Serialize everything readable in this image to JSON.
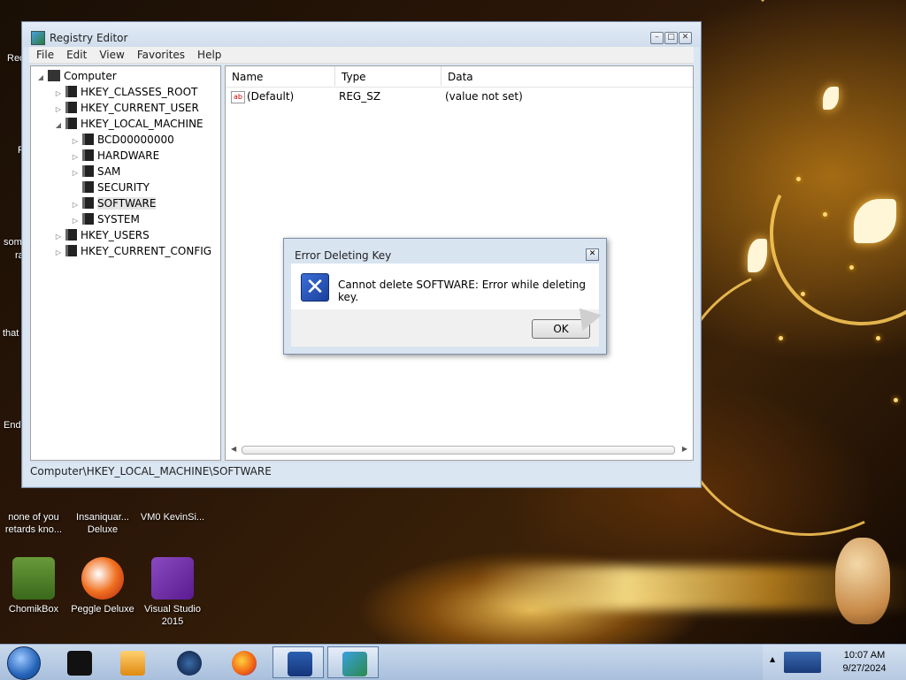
{
  "window": {
    "title": "Registry Editor",
    "minimize": "–",
    "maximize": "□",
    "close": "✕"
  },
  "menu": [
    "File",
    "Edit",
    "View",
    "Favorites",
    "Help"
  ],
  "tree": {
    "root": "Computer",
    "hkcr": "HKEY_CLASSES_ROOT",
    "hkcu": "HKEY_CURRENT_USER",
    "hklm": "HKEY_LOCAL_MACHINE",
    "hklm_children": [
      "BCD00000000",
      "HARDWARE",
      "SAM",
      "SECURITY",
      "SOFTWARE",
      "SYSTEM"
    ],
    "hku": "HKEY_USERS",
    "hkcc": "HKEY_CURRENT_CONFIG",
    "expander_open": "◢",
    "expander_closed": "▷"
  },
  "list": {
    "headers": [
      "Name",
      "Type",
      "Data"
    ],
    "rows": [
      {
        "name": "(Default)",
        "type": "REG_SZ",
        "data": "(value not set)"
      }
    ],
    "value_icon_text": "ab"
  },
  "statusbar": "Computer\\HKEY_LOCAL_MACHINE\\SOFTWARE",
  "dialog": {
    "title": "Error Deleting Key",
    "message": "Cannot delete SOFTWARE:  Error while deleting key.",
    "ok": "OK",
    "icon_glyph": "✕",
    "close": "✕"
  },
  "desktop": {
    "edge_labels": [
      "Rec",
      "F",
      "som",
      "ra",
      "that",
      "End"
    ],
    "icons": [
      {
        "label": "none of you retards kno..."
      },
      {
        "label": "Insaniquar... Deluxe"
      },
      {
        "label": "VM0 KevinSi..."
      },
      {
        "label": "ChomikBox"
      },
      {
        "label": "Peggle Deluxe"
      },
      {
        "label": "Visual Studio 2015"
      }
    ]
  },
  "taskbar": {
    "time": "10:07 AM",
    "date": "9/27/2024"
  },
  "colors": {
    "window_frame": "#dbe6f3",
    "taskbar": "#b6c9e2",
    "error_icon": "#2b57c2"
  }
}
